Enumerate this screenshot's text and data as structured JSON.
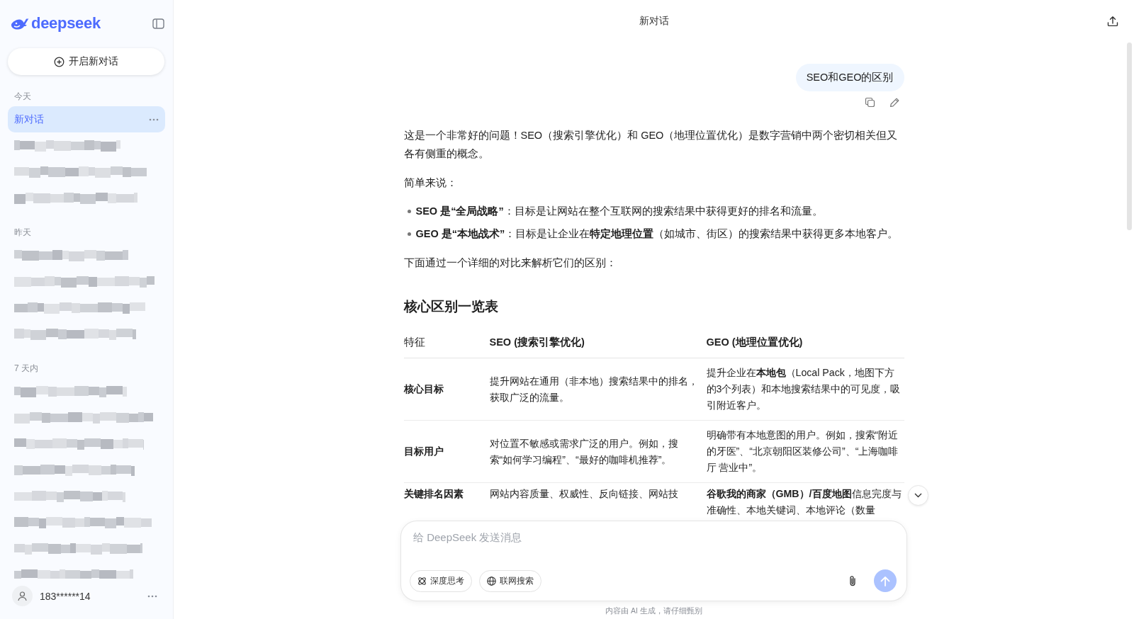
{
  "sidebar": {
    "logo_text": "deepseek",
    "new_chat_button": "开启新对话",
    "groups": [
      {
        "label": "今天",
        "items": [
          {
            "kind": "chat",
            "title": "新对话",
            "selected": true
          },
          {
            "kind": "redacted",
            "selected": false
          },
          {
            "kind": "redacted",
            "selected": false
          },
          {
            "kind": "redacted",
            "selected": false
          }
        ]
      },
      {
        "label": "昨天",
        "items": [
          {
            "kind": "redacted",
            "selected": false
          },
          {
            "kind": "redacted",
            "selected": false
          },
          {
            "kind": "redacted",
            "selected": false
          },
          {
            "kind": "redacted",
            "selected": false
          }
        ]
      },
      {
        "label": "7 天内",
        "items": [
          {
            "kind": "redacted",
            "selected": false
          },
          {
            "kind": "redacted",
            "selected": false
          },
          {
            "kind": "redacted",
            "selected": false
          },
          {
            "kind": "redacted",
            "selected": false
          },
          {
            "kind": "redacted",
            "selected": false
          },
          {
            "kind": "redacted",
            "selected": false
          },
          {
            "kind": "redacted",
            "selected": false
          },
          {
            "kind": "redacted",
            "selected": false
          }
        ]
      }
    ],
    "user": {
      "name": "183******14"
    }
  },
  "header": {
    "title": "新对话"
  },
  "conversation": {
    "user_message": "SEO和GEO的区别",
    "answer": {
      "intro": "这是一个非常好的问题！SEO（搜索引擎优化）和 GEO（地理位置优化）是数字营销中两个密切相关但又各有侧重的概念。",
      "summary_label": "简单来说：",
      "bullets": [
        "**SEO 是“全局战略”**：目标是让网站在整个互联网的搜索结果中获得更好的排名和流量。",
        "**GEO 是“本地战术”**：目标是让企业在**特定地理位置**（如城市、街区）的搜索结果中获得更多本地客户。"
      ],
      "lead_in": "下面通过一个详细的对比来解析它们的区别：",
      "table_title": "核心区别一览表",
      "table": {
        "columns": [
          {
            "label": "特征",
            "emphasized": false
          },
          {
            "label": "SEO (搜索引擎优化)",
            "emphasized": true
          },
          {
            "label": "GEO (地理位置优化)",
            "emphasized": true
          }
        ],
        "rows": [
          [
            "核心目标",
            "提升网站在通用（非本地）搜索结果中的排名，获取广泛的流量。",
            "提升企业在**本地包**（Local Pack，地图下方的3个列表）和本地搜索结果中的可见度，吸引附近客户。"
          ],
          [
            "目标用户",
            "对位置不敏感或需求广泛的用户。例如，搜索“如何学习编程”、“最好的咖啡机推荐”。",
            "明确带有本地意图的用户。例如，搜索“附近的牙医”、“北京朝阳区装修公司”、“上海咖啡厅 营业中”。"
          ],
          [
            "关键排名因素",
            "网站内容质量、权威性、反向链接、网站技",
            "**谷歌我的商家（GMB）/百度地图**信息完度与准确性、本地关键词、本地评论（数量"
          ]
        ]
      }
    }
  },
  "composer": {
    "placeholder": "给 DeepSeek 发送消息",
    "toggles": [
      {
        "kind": "deep-think",
        "label": "深度思考",
        "selected": false
      },
      {
        "kind": "web-search",
        "label": "联网搜索",
        "selected": false
      }
    ],
    "send_disabled": true
  },
  "footer_note": "内容由 AI 生成，请仔细甄别"
}
